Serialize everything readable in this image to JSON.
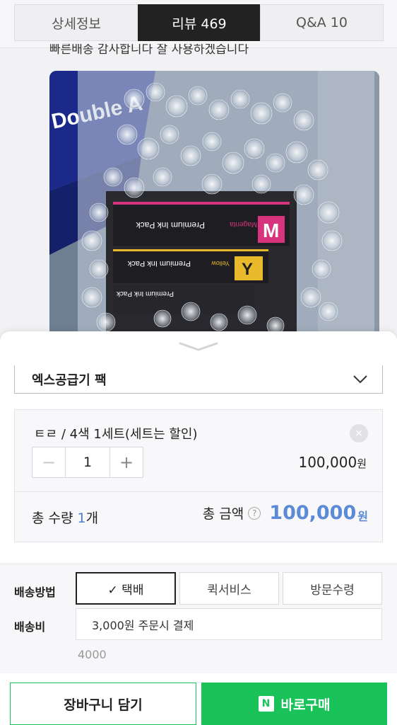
{
  "tabs": [
    {
      "label": "상세정보"
    },
    {
      "label": "리뷰  469"
    },
    {
      "label": "Q&A  10"
    }
  ],
  "review": {
    "text": "빠른배송 감사합니다 잘 사용하겠습니다"
  },
  "product_photo": {
    "box_text": "Double A",
    "cartridges": [
      {
        "letter": "M",
        "name": "Magenta",
        "pack_text": "Premium Ink Pack",
        "color": "#d6357e"
      },
      {
        "letter": "Y",
        "name": "Yellow",
        "pack_text": "Premium Ink Pack",
        "color": "#e8b92a"
      },
      {
        "letter": "",
        "name": "",
        "pack_text": "Premium Ink Pack",
        "color": "#444444"
      }
    ]
  },
  "option_select": {
    "label": "엑스공급기 팩"
  },
  "selected_option": {
    "name": "ㅌㄹ / 4색 1세트(세트는 할인)",
    "remove_icon": "×",
    "minus_icon": "−",
    "quantity": "1",
    "plus_icon": "+",
    "price": "100,000",
    "price_unit": "원"
  },
  "totals": {
    "qty_label": "총 수량 ",
    "qty_value": "1",
    "qty_unit": "개",
    "amount_label": "총 금액",
    "help_icon": "?",
    "amount_value": "100,000",
    "amount_unit": "원"
  },
  "shipping": {
    "method_label": "배송방법",
    "options": [
      {
        "label": "✓ 택배",
        "selected": true
      },
      {
        "label": "퀵서비스",
        "selected": false
      },
      {
        "label": "방문수령",
        "selected": false
      }
    ],
    "fee_label": "배송비",
    "fee_value": "3,000원 주문시 결제",
    "fee_sub": "4000"
  },
  "actions": {
    "cart_label": "장바구니 담기",
    "buy_badge": "N",
    "buy_label": "바로구매"
  },
  "colors": {
    "accent_green": "#19c35a",
    "accent_blue": "#5b8ad6",
    "active_tab": "#222222"
  }
}
